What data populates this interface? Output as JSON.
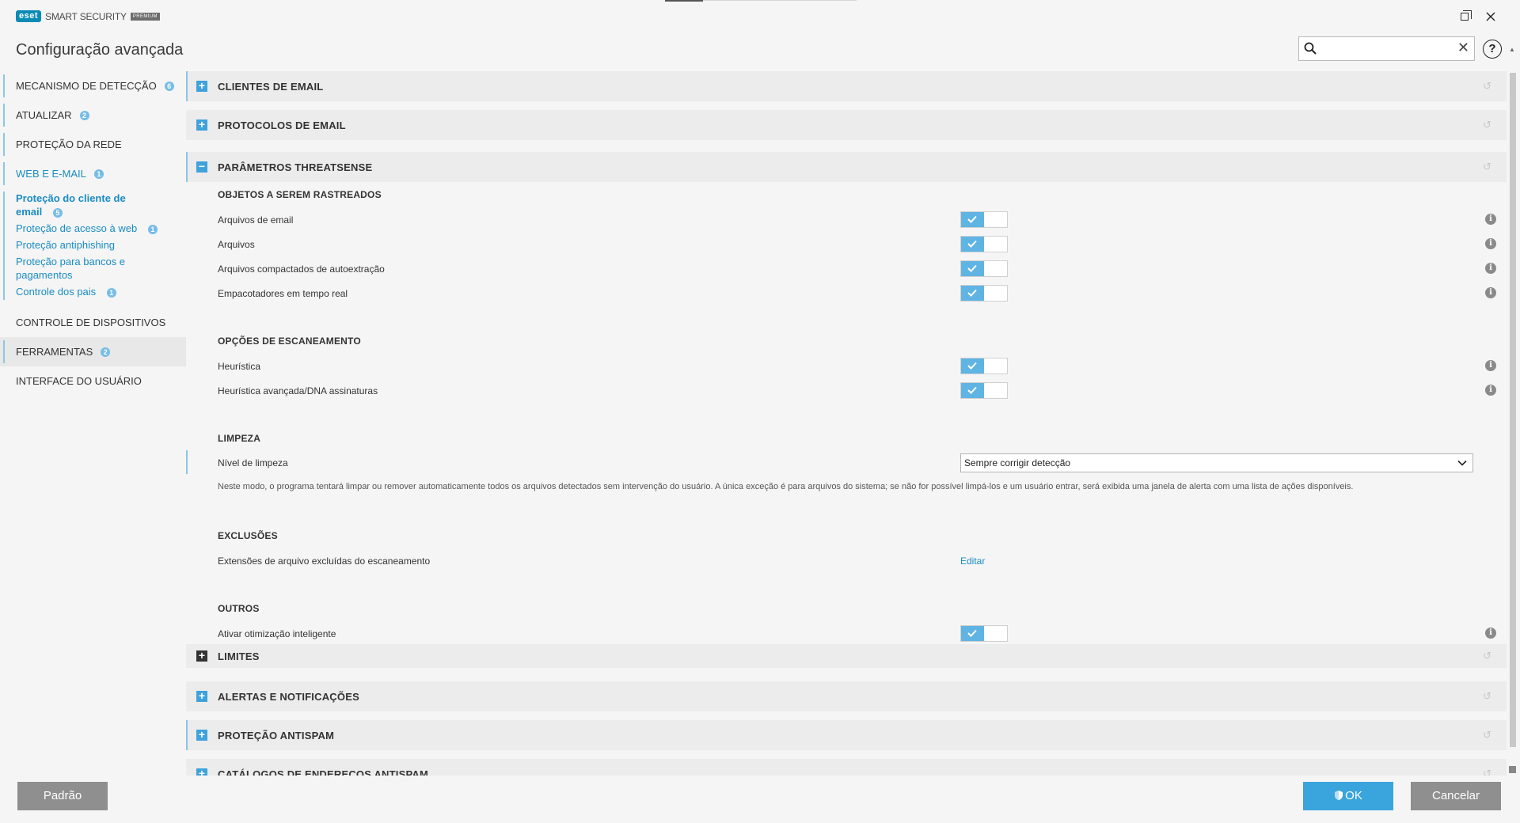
{
  "app": {
    "logo_text": "eset",
    "product": "SMART SECURITY",
    "edition": "PREMIUM",
    "page_title": "Configuração avançada"
  },
  "search": {
    "value": "",
    "placeholder": ""
  },
  "sidebar": {
    "items": [
      {
        "label": "MECANISMO DE DETECÇÃO",
        "badge": "6"
      },
      {
        "label": "ATUALIZAR",
        "badge": "2"
      },
      {
        "label": "PROTEÇÃO DA REDE",
        "badge": ""
      },
      {
        "label": "WEB E E-MAIL",
        "badge": "1"
      },
      {
        "label": "CONTROLE DE DISPOSITIVOS",
        "badge": ""
      },
      {
        "label": "FERRAMENTAS",
        "badge": "2"
      },
      {
        "label": "INTERFACE DO USUÁRIO",
        "badge": ""
      }
    ],
    "sub_items": [
      {
        "label": "Proteção do cliente de email",
        "badge": "5"
      },
      {
        "label": "Proteção de acesso à web",
        "badge": "1"
      },
      {
        "label": "Proteção antiphishing",
        "badge": ""
      },
      {
        "label": "Proteção para bancos e pagamentos",
        "badge": ""
      },
      {
        "label": "Controle dos pais",
        "badge": "1"
      }
    ]
  },
  "sections": {
    "email_clients": "CLIENTES DE EMAIL",
    "email_protocols": "PROTOCOLOS DE EMAIL",
    "threatsense": "PARÂMETROS THREATSENSE",
    "limits": "LIMITES",
    "alerts": "ALERTAS E NOTIFICAÇÕES",
    "antispam": "PROTEÇÃO ANTISPAM",
    "antispam_catalogs": "CATÁLOGOS DE ENDEREÇOS ANTISPAM"
  },
  "threatsense": {
    "objects_title": "OBJETOS A SEREM RASTREADOS",
    "objects": [
      {
        "label": "Arquivos de email",
        "enabled": true
      },
      {
        "label": "Arquivos",
        "enabled": true
      },
      {
        "label": "Arquivos compactados de autoextração",
        "enabled": true
      },
      {
        "label": "Empacotadores em tempo real",
        "enabled": true
      }
    ],
    "scan_options_title": "OPÇÕES DE ESCANEAMENTO",
    "scan_options": [
      {
        "label": "Heurística",
        "enabled": true
      },
      {
        "label": "Heurística avançada/DNA assinaturas",
        "enabled": true
      }
    ],
    "cleaning_title": "LIMPEZA",
    "cleaning_level_label": "Nível de limpeza",
    "cleaning_level_value": "Sempre corrigir detecção",
    "cleaning_description": "Neste modo, o programa tentará limpar ou remover automaticamente todos os arquivos detectados sem intervenção do usuário. A única exceção é para arquivos do sistema; se não for possível limpá-los e um usuário entrar, será exibida uma janela de alerta com uma lista de ações disponíveis.",
    "exclusions_title": "EXCLUSÕES",
    "exclusions_label": "Extensões de arquivo excluídas do escaneamento",
    "exclusions_action": "Editar",
    "others_title": "OUTROS",
    "others": [
      {
        "label": "Ativar otimização inteligente",
        "enabled": true
      }
    ]
  },
  "footer": {
    "default_label": "Padrão",
    "ok_label": "OK",
    "cancel_label": "Cancelar"
  },
  "colors": {
    "accent": "#3aa4dc",
    "toggle_on": "#5fb4e3",
    "link": "#1a8cc4",
    "button_gray": "#8f8f8f"
  }
}
